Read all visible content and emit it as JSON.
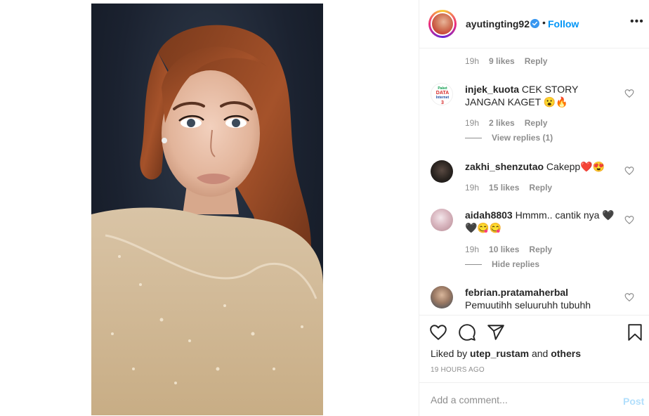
{
  "post": {
    "username": "ayutingting92",
    "separator": "•",
    "follow_label": "Follow",
    "more_label": "•••",
    "photo_alt": "portrait photo"
  },
  "comments": {
    "first_meta": {
      "time": "19h",
      "likes": "9 likes",
      "reply": "Reply"
    },
    "items": [
      {
        "username": "injek_kuota",
        "text": "CEK STORY JANGAN KAGET 😮🔥",
        "time": "19h",
        "likes": "2 likes",
        "reply": "Reply",
        "thread": "View replies (1)",
        "avatar_text": [
          "Paket",
          "DATA",
          "Internet",
          "3"
        ]
      },
      {
        "username": "zakhi_shenzutao",
        "text": "Cakepp❤️😍",
        "time": "19h",
        "likes": "15 likes",
        "reply": "Reply"
      },
      {
        "username": "aidah8803",
        "text": "Hmmm.. cantik nya 🖤🖤😋😋",
        "time": "19h",
        "likes": "10 likes",
        "reply": "Reply",
        "thread": "Hide replies"
      },
      {
        "username": "febrian.pratamaherbal",
        "text": "Pemuutihh seluuruhh tubuhh"
      }
    ]
  },
  "actions": {
    "like_icon": "heart-icon",
    "comment_icon": "comment-icon",
    "share_icon": "share-icon",
    "save_icon": "bookmark-icon",
    "liked_by_prefix": "Liked by",
    "liked_by_user": "utep_rustam",
    "liked_by_and": "and",
    "liked_by_others": "others",
    "timestamp": "19 HOURS AGO"
  },
  "add_comment": {
    "placeholder": "Add a comment...",
    "post_label": "Post"
  },
  "colors": {
    "link_blue": "#0095f6",
    "post_disabled": "#b2dffc",
    "secondary_text": "#8e8e8e",
    "like_red": "#ed4956"
  }
}
